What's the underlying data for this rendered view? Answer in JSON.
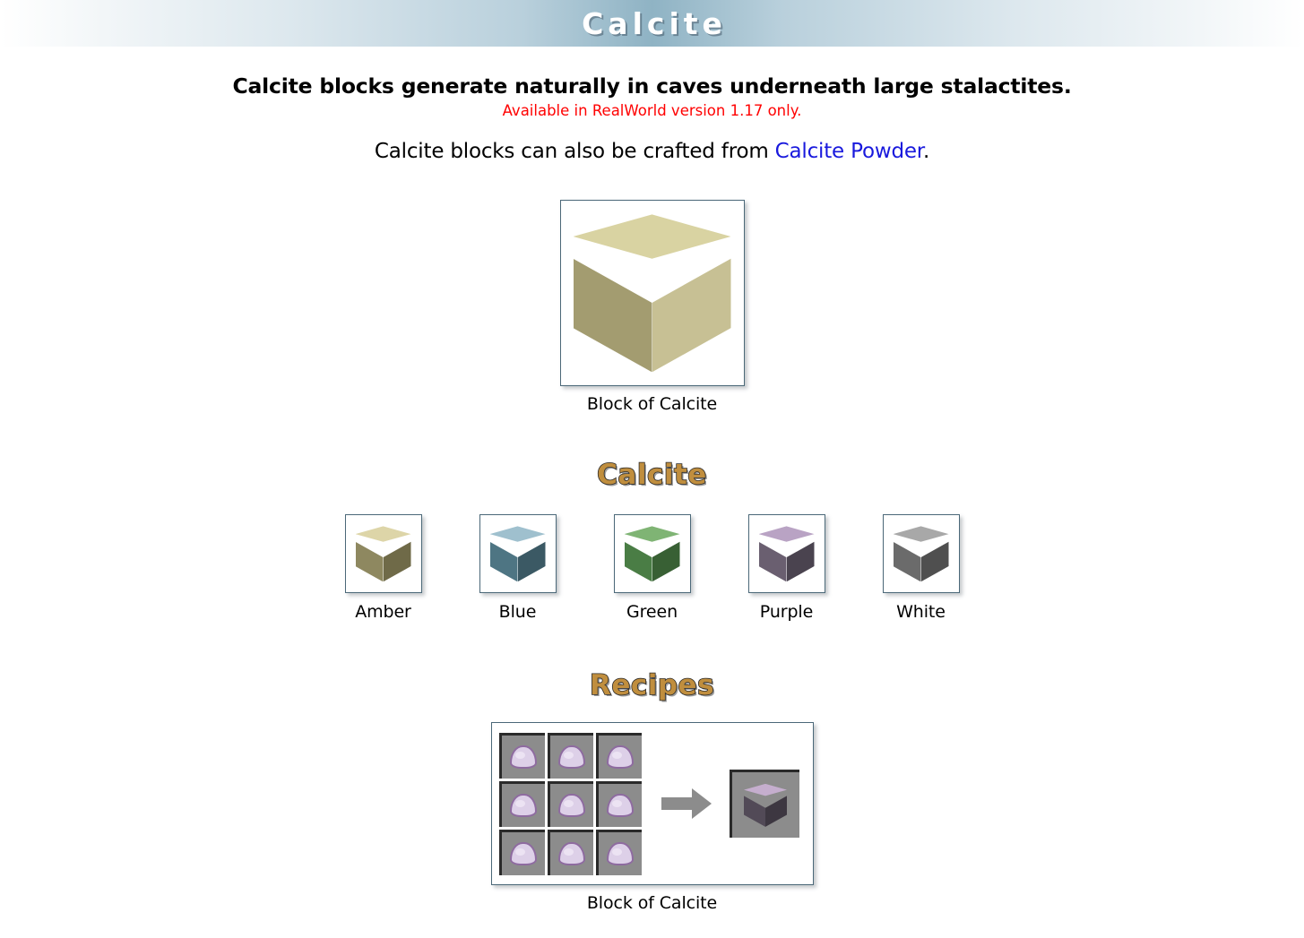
{
  "banner": {
    "title": "Calcite"
  },
  "intro": {
    "line1": "Calcite blocks generate naturally in caves underneath large stalactites.",
    "line2": "Available in RealWorld version 1.17 only.",
    "line3_before": "Calcite blocks can also be crafted from ",
    "line3_link": "Calcite Powder",
    "line3_after": "."
  },
  "main_block": {
    "caption": "Block of Calcite",
    "icon": "calcite-cube-icon"
  },
  "variants_section": {
    "heading": "Calcite",
    "items": [
      {
        "label": "Amber",
        "icon": "amber-calcite-cube-icon"
      },
      {
        "label": "Blue",
        "icon": "blue-calcite-cube-icon"
      },
      {
        "label": "Green",
        "icon": "green-calcite-cube-icon"
      },
      {
        "label": "Purple",
        "icon": "purple-calcite-cube-icon"
      },
      {
        "label": "White",
        "icon": "white-calcite-cube-icon"
      }
    ]
  },
  "recipes_section": {
    "heading": "Recipes",
    "recipe": {
      "caption": "Block of Calcite",
      "ingredient_icon": "calcite-powder-icon",
      "ingredient_count": 9,
      "arrow_icon": "arrow-right-icon",
      "result_icon": "purple-calcite-cube-icon"
    }
  },
  "colors": {
    "link": "#1919dd",
    "warning": "#ff0000",
    "heading_gold": "#c08e3e",
    "banner_accent": "#8fb3c4",
    "frame_border": "#4b6878"
  }
}
